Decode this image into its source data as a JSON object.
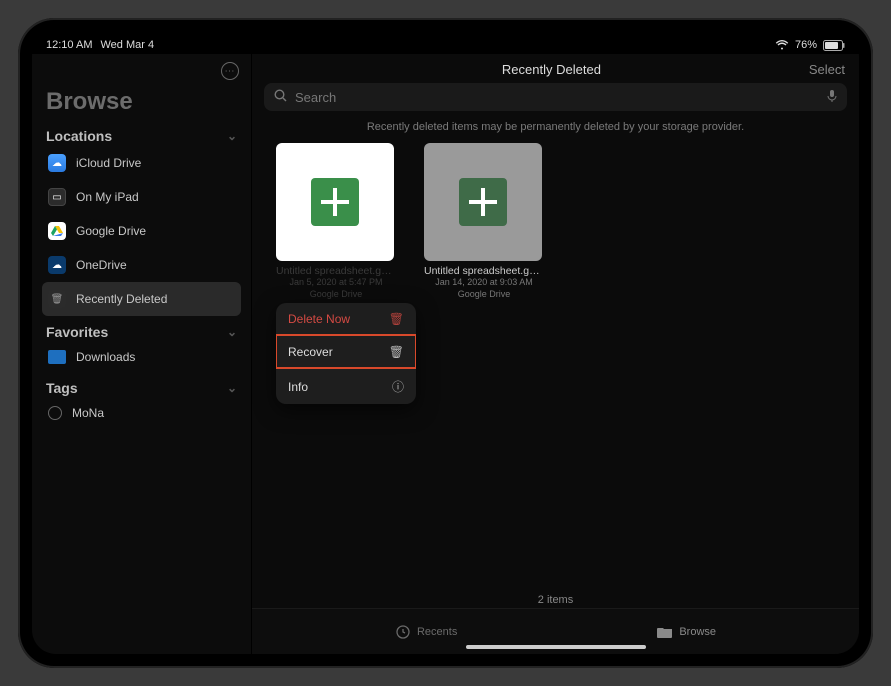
{
  "status": {
    "time": "12:10 AM",
    "date": "Wed Mar 4",
    "battery_pct": "76%"
  },
  "browse_title": "Browse",
  "sections": {
    "locations_label": "Locations",
    "favorites_label": "Favorites",
    "tags_label": "Tags"
  },
  "locations": [
    {
      "label": "iCloud Drive"
    },
    {
      "label": "On My iPad"
    },
    {
      "label": "Google Drive"
    },
    {
      "label": "OneDrive"
    },
    {
      "label": "Recently Deleted"
    }
  ],
  "favorites": [
    {
      "label": "Downloads"
    }
  ],
  "tags": [
    {
      "label": "MoNa"
    }
  ],
  "header": {
    "title": "Recently Deleted",
    "select_label": "Select"
  },
  "search": {
    "placeholder": "Search"
  },
  "notice_text": "Recently deleted items may be permanently deleted by your storage provider.",
  "files": [
    {
      "name": "Untitled spreadsheet.gsheet",
      "meta1": "Jan 5, 2020 at 5:47 PM",
      "meta2": "Google Drive"
    },
    {
      "name": "Untitled spreadsheet.gsheet",
      "meta1": "Jan 14, 2020 at 9:03 AM",
      "meta2": "Google Drive"
    }
  ],
  "context_menu": {
    "delete_label": "Delete Now",
    "recover_label": "Recover",
    "info_label": "Info"
  },
  "footer": {
    "count_text": "2 items"
  },
  "tabs": {
    "recents_label": "Recents",
    "browse_label": "Browse"
  }
}
